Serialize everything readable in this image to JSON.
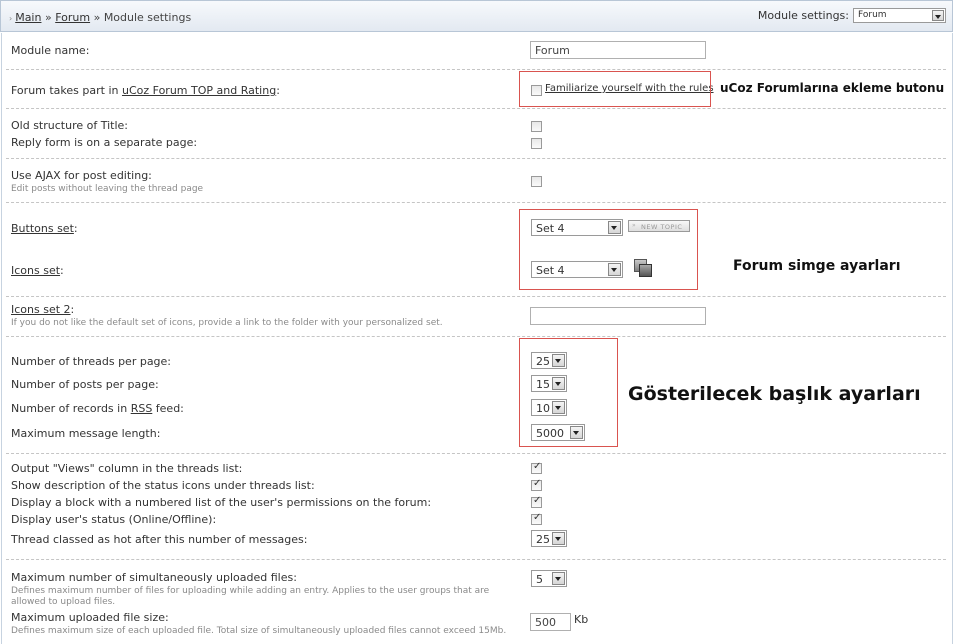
{
  "breadcrumb": {
    "main": "Main",
    "sep": "»",
    "forum": "Forum",
    "current": "Module settings"
  },
  "module_settings": {
    "label": "Module settings:",
    "value": "Forum"
  },
  "fields": {
    "module_name": {
      "label": "Module name:",
      "value": "Forum"
    },
    "forum_top": {
      "label_prefix": "Forum takes part in ",
      "link": "uCoz Forum TOP and Rating",
      "label_suffix": ":",
      "checkbox_label": "Familiarize yourself with the rules",
      "checked": false
    },
    "old_structure": {
      "label": "Old structure of Title:",
      "checked": false
    },
    "reply_form": {
      "label": "Reply form is on a separate page:",
      "checked": false
    },
    "ajax": {
      "label": "Use AJAX for post editing:",
      "sub": "Edit posts without leaving the thread page",
      "checked": false
    },
    "buttons_set": {
      "link": "Buttons set",
      "suffix": ":",
      "value": "Set 4",
      "preview": "NEW TOPIC"
    },
    "icons_set": {
      "link": "Icons set",
      "suffix": ":",
      "value": "Set 4"
    },
    "icons_set2": {
      "link": "Icons set 2",
      "suffix": ":",
      "sub": "If you do not like the default set of icons, provide a link to the folder with your personalized set.",
      "value": ""
    },
    "threads_per_page": {
      "label": "Number of threads per page:",
      "value": "25"
    },
    "posts_per_page": {
      "label": "Number of posts per page:",
      "value": "15"
    },
    "rss_records": {
      "label_prefix": "Number of records in ",
      "rss": "RSS",
      "label_suffix": " feed:",
      "value": "10"
    },
    "max_length": {
      "label": "Maximum message length:",
      "value": "5000"
    },
    "views_column": {
      "label": "Output \"Views\" column in the threads list:",
      "checked": true
    },
    "status_icons": {
      "label": "Show description of the status icons under threads list:",
      "checked": true
    },
    "permissions_block": {
      "label": "Display a block with a numbered list of the user's permissions on the forum:",
      "checked": true
    },
    "user_status": {
      "label": "Display user's status (Online/Offline):",
      "checked": true
    },
    "hot_thread": {
      "label": "Thread classed as hot after this number of messages:",
      "value": "25"
    },
    "max_uploads": {
      "label": "Maximum number of simultaneously uploaded files:",
      "sub": "Defines maximum number of files for uploading while adding an entry. Applies to the user groups that are allowed to upload files.",
      "value": "5"
    },
    "max_file_size": {
      "label": "Maximum uploaded file size:",
      "sub": "Defines maximum size of each uploaded file. Total size of simultaneously uploaded files cannot exceed 15Mb.",
      "value": "500",
      "unit": "Kb"
    }
  },
  "annotations": {
    "forum_add_button": "uCoz Forumlarına ekleme  butonu",
    "icon_settings": "Forum simge ayarları",
    "display_settings": "Gösterilecek başlık ayarları"
  },
  "colors": {
    "annotation_border": "#d9534f",
    "header_bg": "#e3e9f1"
  }
}
